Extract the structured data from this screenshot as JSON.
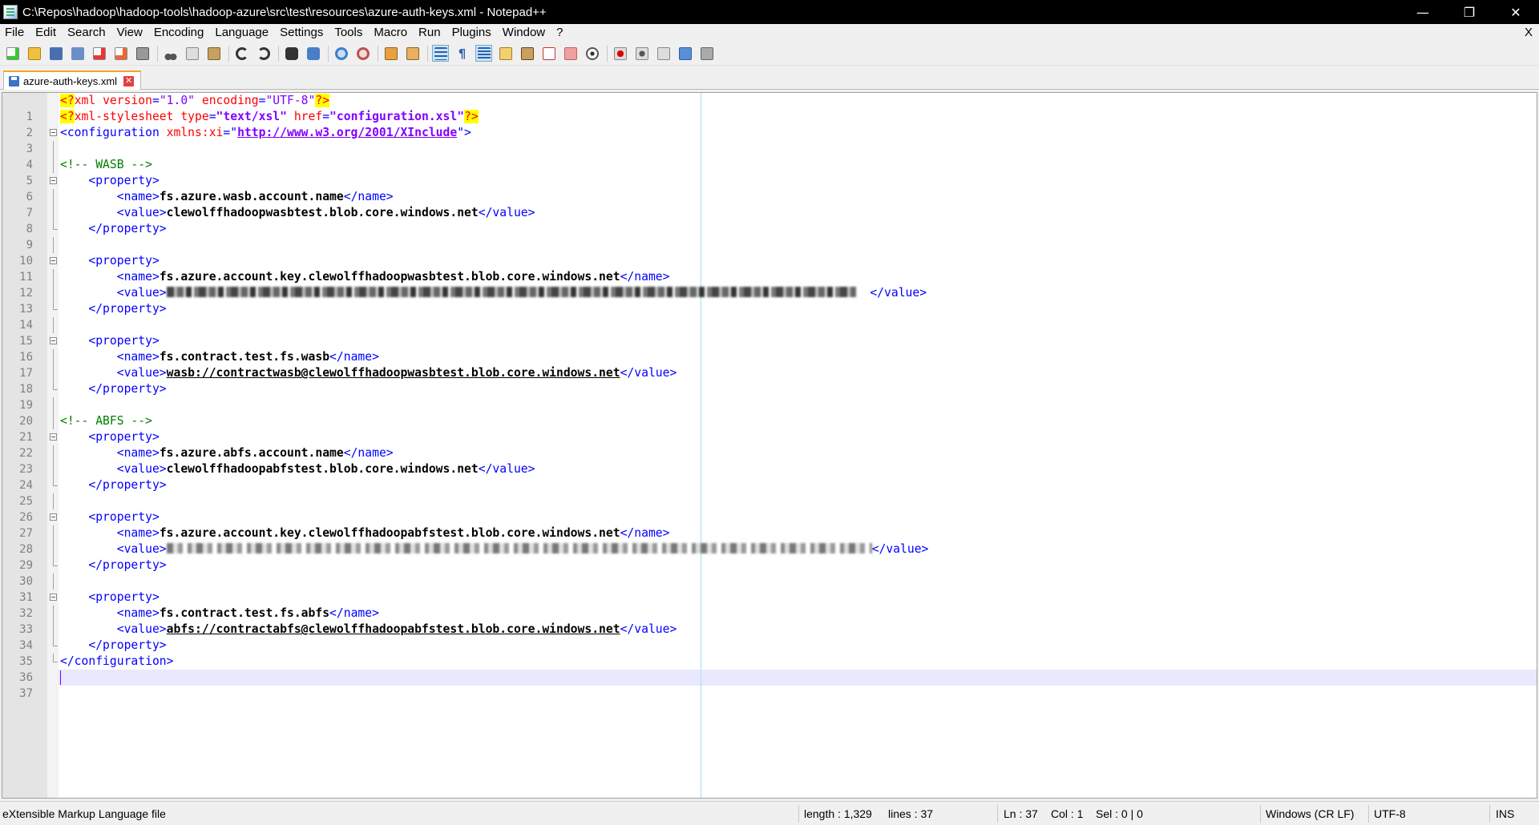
{
  "window": {
    "title": "C:\\Repos\\hadoop\\hadoop-tools\\hadoop-azure\\src\\test\\resources\\azure-auth-keys.xml - Notepad++",
    "minimize": "—",
    "restore": "❐",
    "close": "✕"
  },
  "menu": {
    "items": [
      "File",
      "Edit",
      "Search",
      "View",
      "Encoding",
      "Language",
      "Settings",
      "Tools",
      "Macro",
      "Run",
      "Plugins",
      "Window",
      "?"
    ],
    "close_doc": "X"
  },
  "tab": {
    "label": "azure-auth-keys.xml",
    "close": "✕"
  },
  "editor": {
    "line_numbers": [
      "1",
      "2",
      "3",
      "4",
      "5",
      "6",
      "7",
      "8",
      "9",
      "10",
      "11",
      "12",
      "13",
      "14",
      "15",
      "16",
      "17",
      "18",
      "19",
      "20",
      "21",
      "22",
      "23",
      "24",
      "25",
      "26",
      "27",
      "28",
      "29",
      "30",
      "31",
      "32",
      "33",
      "34",
      "35",
      "36",
      "37"
    ],
    "text": {
      "l1_open": "<?",
      "l1_xml": "xml ",
      "l1_a1": "version",
      "l1_eq1": "=",
      "l1_v1": "\"1.0\"",
      "l1_a2": " encoding",
      "l1_eq2": "=",
      "l1_v2": "\"UTF-8\"",
      "l1_close": "?>",
      "l2_open": "<?",
      "l2_xml": "xml-stylesheet ",
      "l2_a1": "type",
      "l2_eq1": "=",
      "l2_v1": "\"text/xsl\"",
      "l2_a2": " href",
      "l2_eq2": "=",
      "l2_v2": "\"configuration.xsl\"",
      "l2_close": "?>",
      "l3_tag": "<configuration ",
      "l3_attr": "xmlns:xi",
      "l3_eq": "=\"",
      "l3_url": "http://www.w3.org/2001/XInclude",
      "l3_end": "\">",
      "c_wasb": "<!-- WASB -->",
      "c_abfs": "<!-- ABFS -->",
      "indent1": "    ",
      "indent2": "        ",
      "prop_open": "<property>",
      "prop_close": "</property>",
      "name_open": "<name>",
      "name_close": "</name>",
      "value_open": "<value>",
      "value_close": "</value>",
      "value_close_sp": "  </value>",
      "conf_close": "</configuration>",
      "n7": "fs.azure.wasb.account.name",
      "v8": "clewolffhadoopwasbtest.blob.core.windows.net",
      "n12": "fs.azure.account.key.clewolffhadoopwasbtest.blob.core.windows.net",
      "n17": "fs.contract.test.fs.wasb",
      "v18": "wasb://contractwasb@clewolffhadoopwasbtest.blob.core.windows.net",
      "n23": "fs.azure.abfs.account.name",
      "v24": "clewolffhadoopabfstest.blob.core.windows.net",
      "n28": "fs.azure.account.key.clewolffhadoopabfstest.blob.core.windows.net",
      "n33": "fs.contract.test.fs.abfs",
      "v34": "abfs://contractabfs@clewolffhadoopabfstest.blob.core.windows.net"
    }
  },
  "status": {
    "file_type": "eXtensible Markup Language file",
    "length": "length : 1,329",
    "lines": "lines : 37",
    "ln": "Ln : 37",
    "col": "Col : 1",
    "sel": "Sel : 0 | 0",
    "eol": "Windows (CR LF)",
    "encoding": "UTF-8",
    "mode": "INS"
  }
}
